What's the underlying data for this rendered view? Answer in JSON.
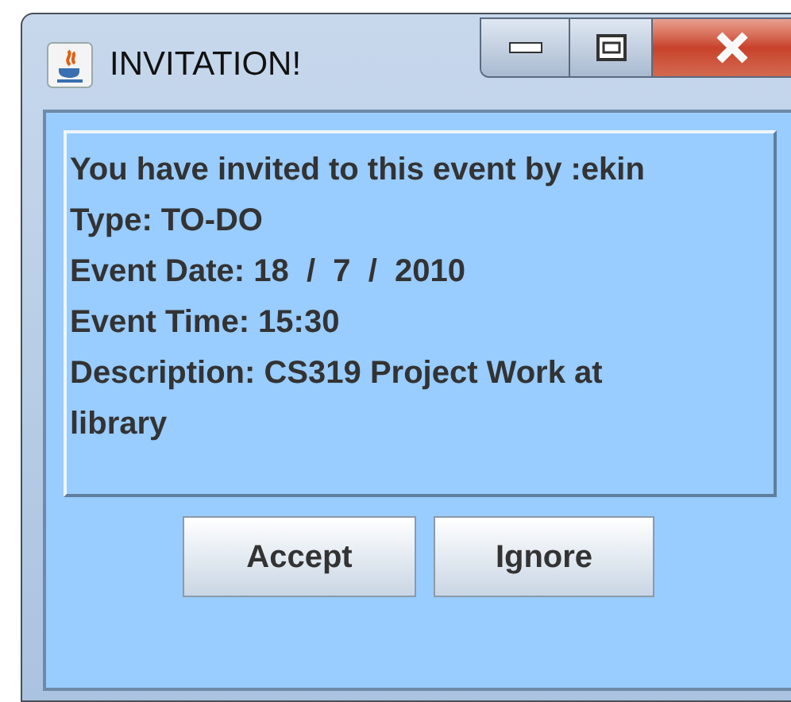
{
  "window": {
    "title": "INVITATION!"
  },
  "message_lines": [
    "You have invited to this event by :ekin",
    "Type: TO-DO",
    "Event Date: 18  /  7  /  2010",
    "Event Time: 15:30",
    "Description: CS319 Project Work at",
    "library"
  ],
  "buttons": [
    "Accept",
    "Ignore"
  ]
}
